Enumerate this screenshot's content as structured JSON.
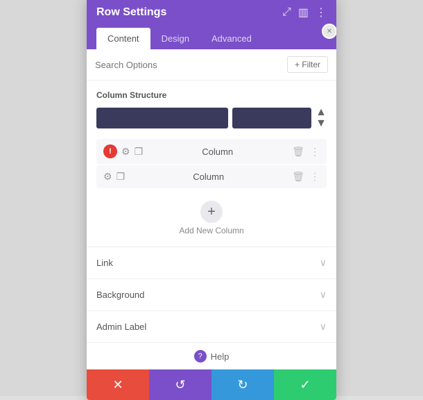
{
  "panel": {
    "title": "Row Settings",
    "tabs": [
      {
        "id": "content",
        "label": "Content",
        "active": true
      },
      {
        "id": "design",
        "label": "Design",
        "active": false
      },
      {
        "id": "advanced",
        "label": "Advanced",
        "active": false
      }
    ]
  },
  "search": {
    "placeholder": "Search Options",
    "filter_label": "+ Filter"
  },
  "column_structure": {
    "title": "Column Structure"
  },
  "columns": [
    {
      "id": 1,
      "label": "Column",
      "has_error": true
    },
    {
      "id": 2,
      "label": "Column",
      "has_error": false
    }
  ],
  "add_column": {
    "label": "Add New Column"
  },
  "accordions": [
    {
      "id": "link",
      "label": "Link"
    },
    {
      "id": "background",
      "label": "Background"
    },
    {
      "id": "admin_label",
      "label": "Admin Label"
    }
  ],
  "help": {
    "label": "Help"
  },
  "footer": {
    "cancel": "✕",
    "undo": "↺",
    "redo": "↻",
    "save": "✓"
  },
  "icons": {
    "maximize": "⤢",
    "columns": "▥",
    "more": "⋮",
    "close": "✕",
    "gear": "⚙",
    "copy": "❐",
    "trash": "🗑",
    "chevron_down": "∨",
    "plus": "+"
  }
}
